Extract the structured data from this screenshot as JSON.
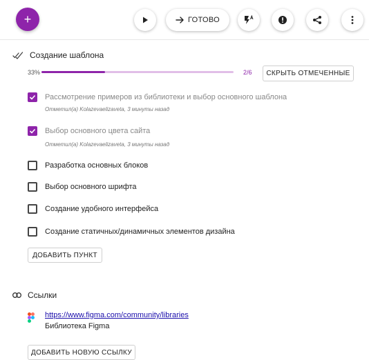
{
  "toolbar": {
    "add_label": "+",
    "done_label": "ГОТОВО"
  },
  "checklist": {
    "title": "Создание шаблона",
    "progress_text": "33%",
    "progress_fraction": 0.33,
    "count_text": "2/6",
    "hide_checked_label": "СКРЫТЬ ОТМЕЧЕННЫЕ",
    "items": [
      {
        "label": "Рассмотрение примеров из библиотеки и выбор основного шаблона",
        "checked": true,
        "meta": "Отметил(а) Kolazevaelizaveta, 3 минуты назад"
      },
      {
        "label": "Выбор основного цвета сайта",
        "checked": true,
        "meta": "Отметил(а) Kolazevaelizaveta, 3 минуты назад"
      },
      {
        "label": "Разработка основных блоков",
        "checked": false
      },
      {
        "label": "Выбор основного шрифта",
        "checked": false
      },
      {
        "label": "Создание удобного интерфейса",
        "checked": false
      },
      {
        "label": "Создание статичных/динамичных элементов дизайна",
        "checked": false
      }
    ],
    "add_item_label": "ДОБАВИТЬ ПУНКТ"
  },
  "links": {
    "title": "Ссылки",
    "items": [
      {
        "url": "https://www.figma.com/community/libraries",
        "title": "Библиотека Figma"
      }
    ],
    "add_link_label": "ДОБАВИТЬ НОВУЮ ССЫЛКУ"
  },
  "colors": {
    "accent": "#8e24aa",
    "accent_light": "#e1bee7"
  },
  "icons": [
    "plus-icon",
    "play-icon",
    "arrow-right-icon",
    "flash-auto-icon",
    "alert-icon",
    "share-icon",
    "more-vert-icon",
    "double-check-icon",
    "link-icon",
    "figma-icon",
    "check-icon"
  ]
}
